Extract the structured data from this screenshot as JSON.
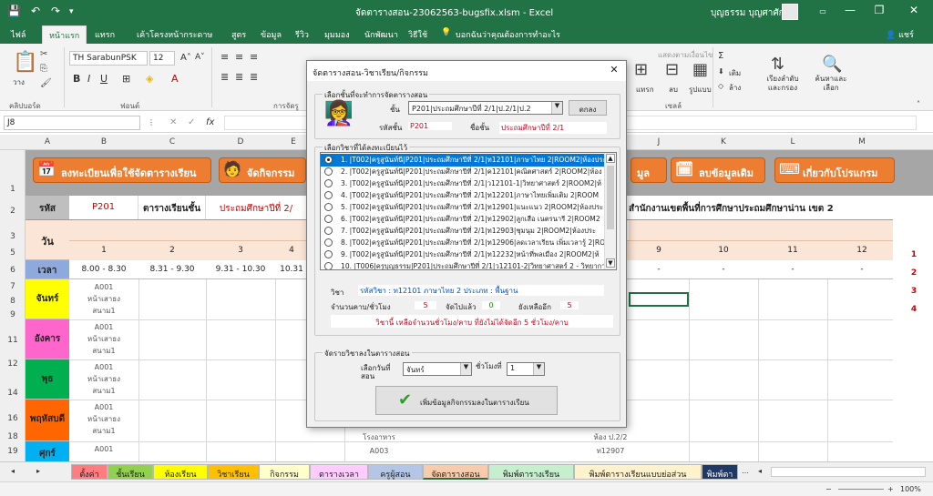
{
  "window": {
    "title": "จัดตารางสอน-23062563-bugsfix.xlsm  -  Excel",
    "user": "บุญธรรม บุญศาศักดิ์",
    "min_glyph": "—",
    "max_glyph": "❐",
    "close_glyph": "✕"
  },
  "quick_access": {
    "save": "💾",
    "undo": "↶",
    "redo": "↷",
    "more": "▾"
  },
  "ribbon_tabs": [
    "ไฟล์",
    "หน้าแรก",
    "แทรก",
    "เค้าโครงหน้ากระดาษ",
    "สูตร",
    "ข้อมูล",
    "รีวิว",
    "มุมมอง",
    "นักพัฒนา",
    "วิธีใช้"
  ],
  "tell_me": "บอกฉันว่าคุณต้องการทำอะไร",
  "share": "แชร์",
  "ribbon": {
    "clipboard_label": "คลิปบอร์ด",
    "paste_label": "วาง",
    "font_label": "ฟอนต์",
    "font_name": "TH SarabunPSK",
    "font_size": "12",
    "format_label": "การจัดรู",
    "cells_label": "เซลล์",
    "insert": "แทรก",
    "delete": "ลบ",
    "format": "รูปแบบ",
    "sort_filter": "เรียงลำดับและกรอง",
    "find_select": "ค้นหาและเลือก",
    "fill": "เติม",
    "clear": "ล้าง",
    "conditional": "แสดงตามเงื่อนไข"
  },
  "formula_bar": {
    "name_box": "J8",
    "fx": "fx",
    "value": ""
  },
  "columns": [
    "A",
    "B",
    "C",
    "D",
    "E",
    "F",
    "G",
    "H",
    "I",
    "J",
    "K",
    "L",
    "M"
  ],
  "rows": [
    "1",
    "2",
    "3",
    "4",
    "5",
    "6",
    "7",
    "8",
    "9",
    "10",
    "11",
    "12",
    "13",
    "14",
    "15",
    "16",
    "17",
    "18",
    "19",
    "20"
  ],
  "sheet": {
    "btn_register": "ลงทะเบียนเพื่อใช้จัดตารางเรียน",
    "btn_activity": "จัดกิจกรรม",
    "btn_data": "มูล",
    "btn_delete": "ลบข้อมูลเดิม",
    "btn_about": "เกี่ยวกับโปรแกรม",
    "code_label": "รหัส",
    "code_value": "P201",
    "timetable_label": "ตารางเรียนชั้น",
    "class_value": "ประถมศึกษาปีที่ 2/",
    "office": "สำนักงานเขตพื้นที่การศึกษาประถมศึกษาน่าน เขต 2",
    "day_label": "วัน",
    "time_label": "เวลา",
    "periods": [
      "1",
      "2",
      "3",
      "4",
      "9",
      "10",
      "11",
      "12"
    ],
    "times": [
      "8.00 - 8.30",
      "8.31 - 9.30",
      "9.31 - 10.30",
      "10.31",
      "-",
      "-",
      "-",
      "-"
    ],
    "days": [
      {
        "name": "จันทร์",
        "color": "#ffff00"
      },
      {
        "name": "อังคาร",
        "color": "#ff66cc"
      },
      {
        "name": "พุธ",
        "color": "#00b050"
      },
      {
        "name": "พฤหัสบดี",
        "color": "#ff6600"
      },
      {
        "name": "ศุกร์",
        "color": "#00b0f0"
      }
    ],
    "slot_lines": [
      "A001",
      "หน้าเสาธง",
      "สนาม1"
    ],
    "right_numbers": [
      "1",
      "2",
      "3",
      "4"
    ],
    "bottom_cells": [
      "โรงอาหาร",
      "A003",
      "ห้อง ป.2/2",
      "ท12907"
    ]
  },
  "dialog": {
    "title": "จัดตารางสอน-วิชาเรียน/กิจกรรม",
    "close": "✕",
    "section1": "เลือกชั้นที่จะทำการจัดตารางสอน",
    "class_label": "ชั้น",
    "class_combo": "P201|ประถมศึกษาปีที่ 2/1|ป.2/1|ป.2",
    "ok_button": "ตกลง",
    "class_code_label": "รหัสชั้น",
    "class_code_value": "P201",
    "class_name_label": "ชื่อชั้น",
    "class_name_value": "ประถมศึกษาปีที่ 2/1",
    "section2": "เลือกวิชาที่ได้ลงทะเบียนไว้",
    "subjects": [
      "1. |T002|ครูสูนันท์นี|P201|ประถมศึกษาปีที่ 2/1|ท12101|ภาษาไทย 2|ROOM2|ห้องประ",
      "2. |T002|ครูสูนันท์นี|P201|ประถมศึกษาปีที่ 2/1|ค12101|คณิตศาสตร์ 2|ROOM2|ห้อง",
      "3. |T002|ครูสูนันท์นี|P201|ประถมศึกษาปีที่ 2/1|ว12101-1|วิทยาศาสตร์ 2|ROOM2|ห้",
      "4. |T002|ครูสูนันท์นี|P201|ประถมศึกษาปีที่ 2/1|ท12201|ภาษาไทยเพิ่มเติม 2|ROOM",
      "5. |T002|ครูสูนันท์นี|P201|ประถมศึกษาปีที่ 2/1|ท12901|แนะแนว 2|ROOM2|ห้องประ",
      "6. |T002|ครูสูนันท์นี|P201|ประถมศึกษาปีที่ 2/1|ท12902|ลูกเสือ เนตรนารี 2|ROOM2",
      "7. |T002|ครูสูนันท์นี|P201|ประถมศึกษาปีที่ 2/1|ท12903|ชุมนุม 2|ROOM2|ห้องประ",
      "8. |T002|ครูสูนันท์นี|P201|ประถมศึกษาปีที่ 2/1|ท12906|ลดเวลาเรียน เพิ่มเวลารู้ 2|RO",
      "9. |T002|ครูสูนันท์นี|P201|ประถมศึกษาปีที่ 2/1|ท12232|หน้าที่พลเมือง 2|ROOM2|ห้",
      "10. |T006|ครูบุญธรรม|P201|ประถมศึกษาปีที่ 2/1|ว12101-2|วิทยาศาสตร์ 2 - วิทยาการ"
    ],
    "subject_label": "วิชา",
    "subject_value": "รหัสวิชา : ท12101 ภาษาไทย 2 ประเภท : พื้นฐาน",
    "hours_label": "จำนวนคาบ/ชั่วโมง",
    "hours_value": "5",
    "used_label": "จัดไปแล้ว",
    "used_value": "0",
    "remain_label": "ยังเหลืออีก",
    "remain_value": "5",
    "note": "วิชานี้ เหลือจำนวนชั่วโมง/คาบ ที่ยังไม่ได้จัดอีก 5 ชั่วโมง/คาบ",
    "section3": "จัดรายวิชาลงในตารางสอน",
    "day_select_label": "เลือกวันที่สอน",
    "day_select_value": "จันทร์",
    "period_label": "ชั่วโมงที่",
    "period_value": "1",
    "add_button": "เพิ่มข้อมูลกิจกรรมลงในตารางเรียน"
  },
  "sheet_tabs": [
    {
      "label": "ตั้งค่า",
      "color": "#ff7c80"
    },
    {
      "label": "ชั้นเรียน",
      "color": "#92d050"
    },
    {
      "label": "ห้องเรียน",
      "color": "#ffff00"
    },
    {
      "label": "วิชาเรียน",
      "color": "#ffc000"
    },
    {
      "label": "กิจกรรม",
      "color": "#ffffcc"
    },
    {
      "label": "ตารางเวลา",
      "color": "#ffccff"
    },
    {
      "label": "ครูผู้สอน",
      "color": "#b4c6e7"
    },
    {
      "label": "จัดตารางสอน",
      "color": "#f8cbad"
    },
    {
      "label": "พิมพ์ตารางเรียน",
      "color": "#c6efce"
    },
    {
      "label": "พิมพ์ตารางเรียนแบบย่อส่วน",
      "color": "#fff2cc"
    },
    {
      "label": "พิมพ์ตา",
      "color": "#203864"
    }
  ],
  "status": {
    "zoom": "100%",
    "plus": "+",
    "minus": "−"
  }
}
